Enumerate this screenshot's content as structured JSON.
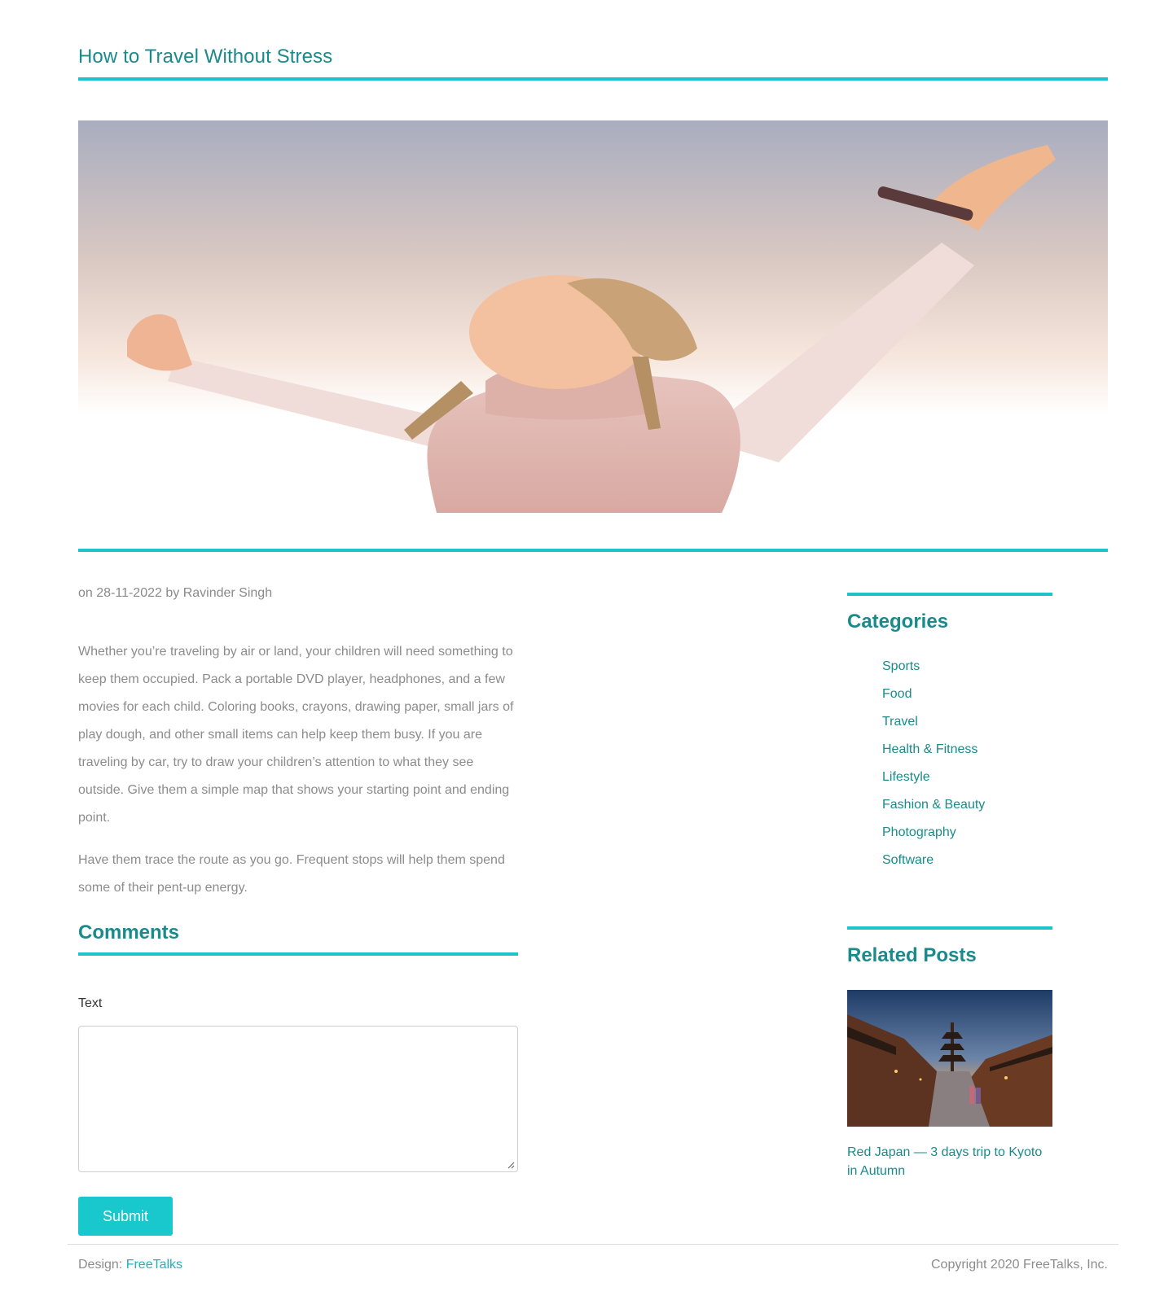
{
  "post": {
    "title": "How to Travel Without Stress",
    "byline": "on 28-11-2022 by Ravinder Singh",
    "paragraphs": [
      "Whether you’re traveling by air or land, your children will need something to keep them occupied. Pack a portable DVD player, headphones, and a few movies for each child. Coloring books, crayons, drawing paper, small jars of play dough, and other small items can help keep them busy. If you are traveling by car, try to draw your children’s attention to what they see outside. Give them a simple map that shows your starting point and ending point.",
      "Have them trace the route as you go. Frequent stops will help them spend some of their pent-up energy."
    ]
  },
  "comments": {
    "title": "Comments",
    "field_label": "Text",
    "textarea_value": "",
    "submit_label": "Submit"
  },
  "sidebar": {
    "categories_title": "Categories",
    "categories": [
      "Sports",
      "Food",
      "Travel",
      "Health & Fitness",
      "Lifestyle",
      "Fashion & Beauty",
      "Photography",
      "Software"
    ],
    "related_title": "Related Posts",
    "related_posts": [
      {
        "title": "Red Japan — 3 days trip to Kyoto in Autumn"
      }
    ]
  },
  "footer": {
    "design_prefix": "Design:",
    "design_link": "FreeTalks",
    "copyright": "Copyright 2020 FreeTalks, Inc."
  },
  "colors": {
    "accent": "#1cc3c9",
    "link": "#1a8a8a",
    "button": "#18c8cc",
    "body_text": "#8c8c8c"
  },
  "icons": {
    "textarea_grip": "resize-grip-icon"
  }
}
